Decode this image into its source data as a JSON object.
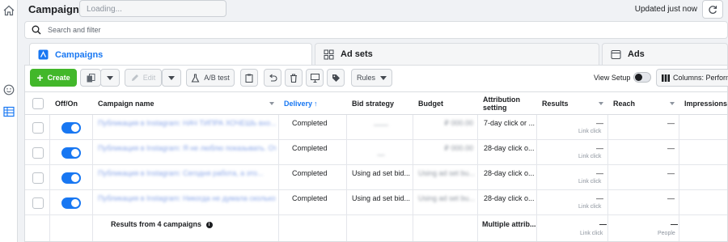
{
  "header": {
    "title": "Campaigns",
    "loading_placeholder": "Loading...",
    "updated": "Updated just now"
  },
  "search": {
    "placeholder": "Search and filter"
  },
  "tabs": [
    {
      "label": "Campaigns",
      "active": true,
      "icon": "campaign-icon"
    },
    {
      "label": "Ad sets",
      "active": false,
      "icon": "grid-icon"
    },
    {
      "label": "Ads",
      "active": false,
      "icon": "ad-icon"
    }
  ],
  "toolbar": {
    "create_label": "Create",
    "edit_label": "Edit",
    "abtest_label": "A/B test",
    "rules_label": "Rules",
    "view_setup_label": "View Setup",
    "columns_label": "Columns: Performance"
  },
  "columns": {
    "offon": "Off/On",
    "name": "Campaign name",
    "delivery": "Delivery",
    "bid": "Bid strategy",
    "budget": "Budget",
    "attribution": "Attribution setting",
    "results": "Results",
    "reach": "Reach",
    "impressions": "Impressions"
  },
  "rows": [
    {
      "name": "Публикация в Instagram: НАЧ ТИПРА ХОЧЕШЬ вхо...",
      "delivery": "Completed",
      "bid": "——",
      "budget": "₽ 000.00",
      "attribution": "7-day click or ...",
      "results": "—",
      "results_sub": "Link click",
      "reach": "—"
    },
    {
      "name": "Публикация в Instagram: Я не люблю показывать. От...",
      "delivery": "Completed",
      "bid": "—",
      "budget": "₽ 000.00",
      "attribution": "28-day click o...",
      "results": "—",
      "results_sub": "Link click",
      "reach": "—"
    },
    {
      "name": "Публикация в Instagram: Сегодня работа, а это...",
      "delivery": "Completed",
      "bid": "Using ad set bid...",
      "budget": "Using ad set bu...",
      "attribution": "28-day click o...",
      "results": "—",
      "results_sub": "Link click",
      "reach": "—"
    },
    {
      "name": "Публикация в Instagram: Никогда не думала сколько...",
      "delivery": "Completed",
      "bid": "Using ad set bid...",
      "budget": "Using ad set bu...",
      "attribution": "28-day click o...",
      "results": "—",
      "results_sub": "Link click",
      "reach": "—"
    }
  ],
  "footer": {
    "results_label": "Results from 4 campaigns",
    "attribution": "Multiple attrib...",
    "results": "—",
    "results_sub": "Link click",
    "reach": "—",
    "reach_sub": "People"
  },
  "colors": {
    "accent": "#1877f2",
    "create": "#42b72a"
  }
}
